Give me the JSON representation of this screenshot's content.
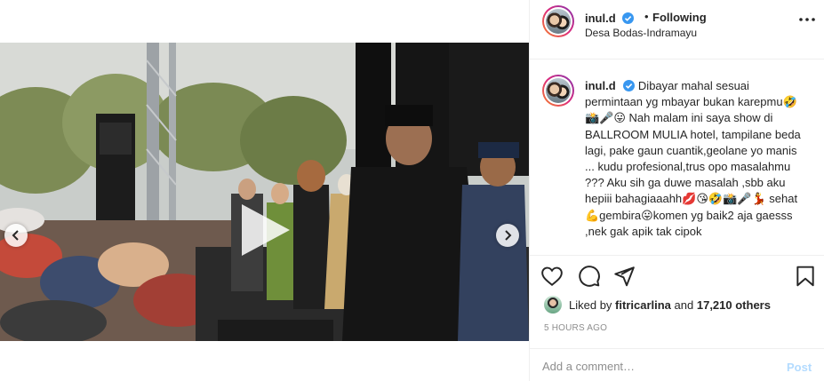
{
  "header": {
    "username": "inul.d",
    "separator": "•",
    "follow_status": "Following",
    "location": "Desa Bodas-Indramayu"
  },
  "caption": {
    "username": "inul.d",
    "text": "Dibayar mahal sesuai permintaan yg mbayar bukan karepmu🤣📸🎤😛 Nah malam ini saya show di BALLROOM MULIA hotel, tampilane beda lagi, pake gaun cuantik,geolane yo manis ... kudu profesional,trus opo masalahmu ??? Aku sih ga duwe masalah ,sbb aku hepiii bahagiaaahh💋😘🤣📸🎤💃 sehat💪gembira😛komen yg baik2 aja gaesss ,nek gak apik tak cipok"
  },
  "likes": {
    "prefix": "Liked by",
    "user": "fitricarlina",
    "and": "and",
    "count": "17,210 others"
  },
  "timestamp": "5 HOURS AGO",
  "comment_box": {
    "placeholder": "Add a comment…",
    "post_label": "Post"
  },
  "colors": {
    "verified": "#3897f0",
    "post_disabled": "#b3dbff",
    "muted": "#8e8e8e"
  },
  "icons": [
    "verified-icon",
    "more-options-icon",
    "heart-icon",
    "comment-icon",
    "share-icon",
    "bookmark-icon",
    "play-icon",
    "chevron-left-icon",
    "chevron-right-icon"
  ]
}
